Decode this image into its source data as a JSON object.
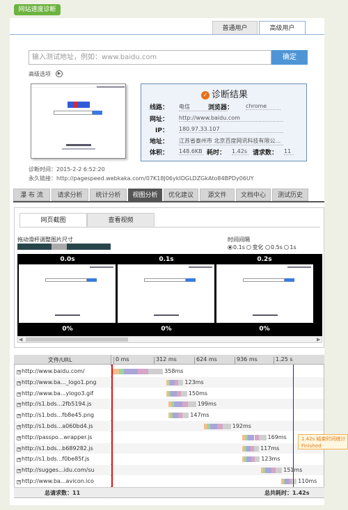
{
  "header": {
    "title": "网站速度诊断"
  },
  "user_tabs": [
    {
      "label": "普通用户"
    },
    {
      "label": "高级用户"
    }
  ],
  "search": {
    "placeholder": "输入测试地址，例如：www.baidu.com",
    "button": "确定"
  },
  "advanced": {
    "label": "高级选项"
  },
  "result": {
    "title": "诊断结果",
    "line_label": "线路：",
    "line_value": "电信",
    "browser_label": "浏览器：",
    "browser_value": "chrome",
    "url_label": "网址：",
    "url_value": "http://www.baidu.com",
    "ip_label": "IP：",
    "ip_value": "180.97.33.107",
    "addr_label": "地址：",
    "addr_value": "江苏省泰州市 北京百度网讯科技有限公...",
    "size_label": "体积：",
    "size_value": "148.6KB",
    "time_label": "耗时：",
    "time_value": "1.42s",
    "req_label": "请求数：",
    "req_value": "11"
  },
  "meta": {
    "diag_time": "诊断时间：2015-2-2 6:52:20",
    "permalink": "永久链接：http://pagespeed.webkaka.com/07K18J06ykIDGLDZGkAto84BPDy06UY"
  },
  "nav_tabs": [
    {
      "label": "瀑 布 流"
    },
    {
      "label": "请求分析"
    },
    {
      "label": "统计分析"
    },
    {
      "label": "视图分析"
    },
    {
      "label": "优化建议"
    },
    {
      "label": "源文件"
    },
    {
      "label": "文档中心"
    },
    {
      "label": "测试历史"
    }
  ],
  "sub_tabs": [
    {
      "label": "网页截图"
    },
    {
      "label": "查看视频"
    }
  ],
  "slider_label": "拖动滑杆调整图片尺寸",
  "interval": {
    "label": "时间间隔",
    "options": [
      "0.1s",
      "变化",
      "0.5s",
      "1s"
    ],
    "selected": "0.1s"
  },
  "frames": [
    {
      "time": "0.0s",
      "pct": "0%"
    },
    {
      "time": "0.1s",
      "pct": "0%"
    },
    {
      "time": "0.2s",
      "pct": "0%"
    }
  ],
  "waterfall": {
    "col_header": "文件/URL",
    "ticks": [
      "0 ms",
      "312 ms",
      "624 ms",
      "936 ms",
      "1.25 s"
    ],
    "rows": [
      {
        "name": "http://www.baidu.com/",
        "time": "358ms",
        "start": 0,
        "dur": 358
      },
      {
        "name": "http://www.ba..._logo1.png",
        "time": "123ms",
        "start": 380,
        "dur": 123
      },
      {
        "name": "http://www.ba...ylogo3.gif",
        "time": "150ms",
        "start": 380,
        "dur": 150
      },
      {
        "name": "http://s1.bds...2fb5194.js",
        "time": "199ms",
        "start": 395,
        "dur": 199
      },
      {
        "name": "http://s1.bds...fb8e45.png",
        "time": "147ms",
        "start": 395,
        "dur": 147
      },
      {
        "name": "http://s1.bds...a060bd4.js",
        "time": "192ms",
        "start": 650,
        "dur": 192
      },
      {
        "name": "http://passpo...wrapper.js",
        "time": "169ms",
        "start": 925,
        "dur": 169
      },
      {
        "name": "http://s1.bds...b689282.js",
        "time": "117ms",
        "start": 925,
        "dur": 117
      },
      {
        "name": "http://s1.bds...f0be85f.js",
        "time": "123ms",
        "start": 925,
        "dur": 123
      },
      {
        "name": "http://sugges...idu.com/su",
        "time": "151ms",
        "start": 1055,
        "dur": 151
      },
      {
        "name": "http://www.ba...avicon.ico",
        "time": "110ms",
        "start": 1200,
        "dur": 110
      }
    ],
    "total_req": "总请求数：11",
    "total_time_label": "总共耗时：",
    "total_time": "1.42s",
    "tooltip_line1": "1.42s 结束时间统计",
    "tooltip_line2": "Finished"
  }
}
